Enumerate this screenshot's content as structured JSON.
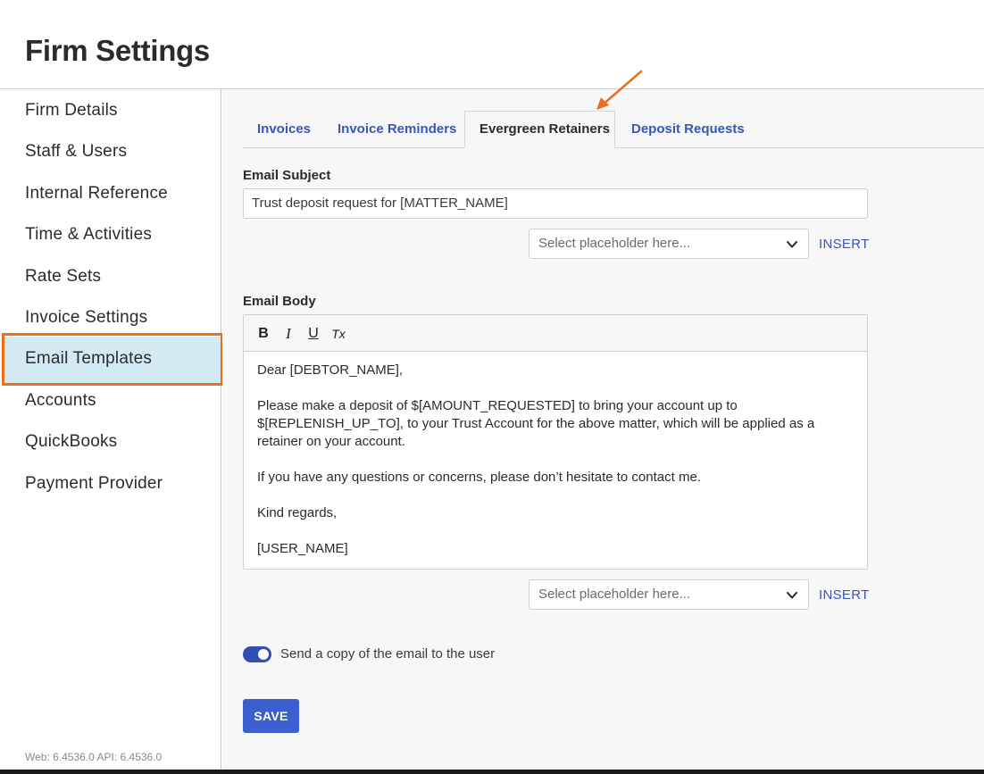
{
  "page": {
    "title": "Firm Settings"
  },
  "sidebar": {
    "items": [
      {
        "label": "Firm Details"
      },
      {
        "label": "Staff & Users"
      },
      {
        "label": "Internal Reference"
      },
      {
        "label": "Time & Activities"
      },
      {
        "label": "Rate Sets"
      },
      {
        "label": "Invoice Settings"
      },
      {
        "label": "Email Templates",
        "active": true
      },
      {
        "label": "Accounts"
      },
      {
        "label": "QuickBooks"
      },
      {
        "label": "Payment Provider"
      }
    ],
    "version": "Web: 6.4536.0 API: 6.4536.0"
  },
  "tabs": [
    {
      "label": "Invoices"
    },
    {
      "label": "Invoice Reminders"
    },
    {
      "label": "Evergreen Retainers",
      "active": true
    },
    {
      "label": "Deposit Requests"
    }
  ],
  "subject": {
    "label": "Email Subject",
    "value": "Trust deposit request for [MATTER_NAME]",
    "placeholder_select": "Select placeholder here...",
    "insert_label": "INSERT"
  },
  "body": {
    "label": "Email Body",
    "toolbar": {
      "bold": "B",
      "italic": "I",
      "underline": "U",
      "clear": "Tx"
    },
    "paragraphs": [
      "Dear [DEBTOR_NAME],",
      "Please make a deposit of $[AMOUNT_REQUESTED] to bring your account up to $[REPLENISH_UP_TO], to your Trust Account for the above matter, which will be applied as a retainer on your account.",
      "If you have any questions or concerns, please don’t hesitate to contact me.",
      "Kind regards,",
      "[USER_NAME]"
    ],
    "placeholder_select": "Select placeholder here...",
    "insert_label": "INSERT"
  },
  "copy_toggle": {
    "label": "Send a copy of the email to the user",
    "on": true
  },
  "save_label": "SAVE",
  "colors": {
    "accent": "#3a5fcf",
    "link": "#3b55b8",
    "active_nav_bg": "#d3eaf4",
    "highlight_outline": "#e8701e"
  }
}
